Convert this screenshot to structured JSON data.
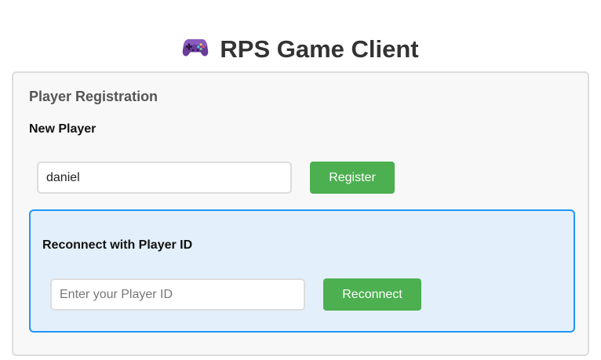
{
  "app": {
    "title": "RPS Game Client",
    "title_icon": "gamepad-icon",
    "accent_color": "#4caf50",
    "info_border_color": "#2196f3",
    "info_background_color": "#e3f0fb"
  },
  "registration": {
    "heading": "Player Registration",
    "new_player": {
      "heading": "New Player",
      "name_value": "daniel",
      "register_label": "Register"
    },
    "reconnect": {
      "heading": "Reconnect with Player ID",
      "player_id_placeholder": "Enter your Player ID",
      "player_id_value": "",
      "reconnect_label": "Reconnect"
    }
  }
}
